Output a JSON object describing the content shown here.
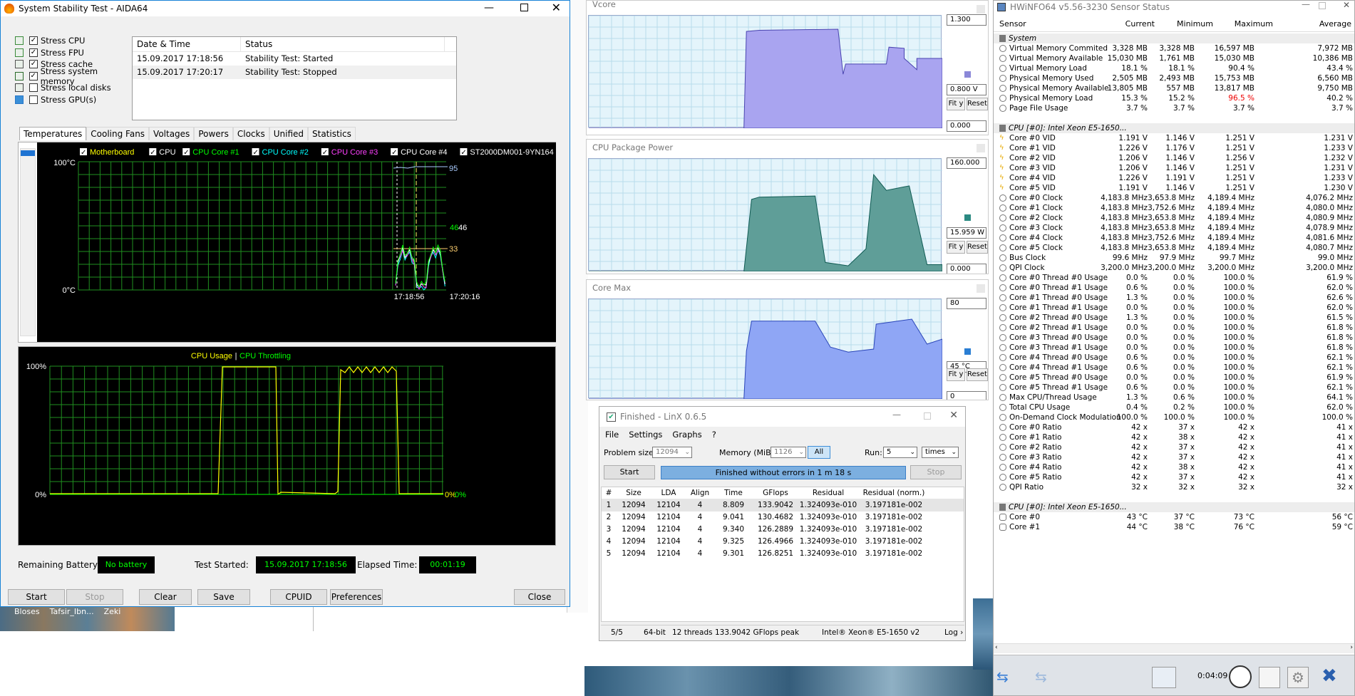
{
  "aida": {
    "title": "System Stability Test - AIDA64",
    "stress": [
      {
        "label": "Stress CPU",
        "checked": true
      },
      {
        "label": "Stress FPU",
        "checked": true
      },
      {
        "label": "Stress cache",
        "checked": true
      },
      {
        "label": "Stress system memory",
        "checked": true
      },
      {
        "label": "Stress local disks",
        "checked": false
      },
      {
        "label": "Stress GPU(s)",
        "checked": false
      }
    ],
    "log_headers": {
      "date": "Date & Time",
      "status": "Status"
    },
    "log": [
      {
        "date": "15.09.2017 17:18:56",
        "status": "Stability Test: Started"
      },
      {
        "date": "15.09.2017 17:20:17",
        "status": "Stability Test: Stopped"
      }
    ],
    "tabs": [
      "Temperatures",
      "Cooling Fans",
      "Voltages",
      "Powers",
      "Clocks",
      "Unified",
      "Statistics"
    ],
    "temp_legend": [
      {
        "label": "Motherboard",
        "color": "#ffff00"
      },
      {
        "label": "CPU",
        "color": "#ffffff"
      },
      {
        "label": "CPU Core #1",
        "color": "#00ff00"
      },
      {
        "label": "CPU Core #2",
        "color": "#00ffff"
      },
      {
        "label": "CPU Core #3",
        "color": "#ff40ff"
      },
      {
        "label": "CPU Core #4",
        "color": "#ffffff"
      },
      {
        "label": "ST2000DM001-9YN164",
        "color": "#ffffff"
      }
    ],
    "temp_chart": {
      "ymax": "100°C",
      "ymin": "0°C",
      "t1": "17:18:56",
      "t2": "17:20:16",
      "v95": "95",
      "v46a": "46",
      "v46b": "46",
      "v33": "33"
    },
    "usage_chart": {
      "title_a": "CPU Usage",
      "sep": "|",
      "title_b": "CPU Throttling",
      "ymax": "100%",
      "ymin": "0%",
      "end_a": "0%",
      "end_b": "0%"
    },
    "status": {
      "battery_label": "Remaining Battery:",
      "battery": "No battery",
      "started_label": "Test Started:",
      "started": "15.09.2017 17:18:56",
      "elapsed_label": "Elapsed Time:",
      "elapsed": "00:01:19"
    },
    "buttons": {
      "start": "Start",
      "stop": "Stop",
      "clear": "Clear",
      "save": "Save",
      "cpuid": "CPUID",
      "prefs": "Preferences",
      "close": "Close"
    }
  },
  "taskbar_items": [
    "Bloses",
    "Tafsir_Ibn...",
    "Zeki"
  ],
  "graphs": [
    {
      "title": "Vcore",
      "top": "1.300",
      "cur": "0.800 V",
      "bottom": "0.000",
      "swatch": "#8b88d8",
      "fity": "Fit y",
      "reset": "Reset"
    },
    {
      "title": "CPU Package Power",
      "top": "160.000",
      "cur": "15.959 W",
      "bottom": "0.000",
      "swatch": "#2b8a82",
      "fity": "Fit y",
      "reset": "Reset"
    },
    {
      "title": "Core Max",
      "top": "80",
      "cur": "45 °C",
      "bottom": "0",
      "swatch": "#2a7ed3",
      "fity": "Fit y",
      "reset": "Reset"
    }
  ],
  "linx": {
    "title": "Finished - LinX 0.6.5",
    "menu": [
      "File",
      "Settings",
      "Graphs",
      "?"
    ],
    "problem_label": "Problem size:",
    "problem": "12094",
    "memory_label": "Memory (MiB):",
    "memory": "1126",
    "all": "All",
    "run_label": "Run:",
    "run": "5",
    "times": "times",
    "start": "Start",
    "status": "Finished without errors in 1 m 18 s",
    "stop": "Stop",
    "headers": [
      "#",
      "Size",
      "LDA",
      "Align",
      "Time",
      "GFlops",
      "Residual",
      "Residual (norm.)"
    ],
    "rows": [
      [
        "1",
        "12094",
        "12104",
        "4",
        "8.809",
        "133.9042",
        "1.324093e-010",
        "3.197181e-002"
      ],
      [
        "2",
        "12094",
        "12104",
        "4",
        "9.041",
        "130.4682",
        "1.324093e-010",
        "3.197181e-002"
      ],
      [
        "3",
        "12094",
        "12104",
        "4",
        "9.340",
        "126.2889",
        "1.324093e-010",
        "3.197181e-002"
      ],
      [
        "4",
        "12094",
        "12104",
        "4",
        "9.325",
        "126.4966",
        "1.324093e-010",
        "3.197181e-002"
      ],
      [
        "5",
        "12094",
        "12104",
        "4",
        "9.301",
        "126.8251",
        "1.324093e-010",
        "3.197181e-002"
      ]
    ],
    "footer": {
      "runs": "5/5",
      "bits": "64-bit",
      "threads": "12 threads",
      "peak": "133.9042 GFlops peak",
      "cpu": "Intel® Xeon® E5-1650 v2",
      "log": "Log ›"
    }
  },
  "hwinfo": {
    "title": "HWiNFO64 v5.56-3230 Sensor Status",
    "headers": [
      "Sensor",
      "Current",
      "Minimum",
      "Maximum",
      "Average"
    ],
    "rows": [
      {
        "type": "group",
        "label": "System"
      },
      {
        "type": "row",
        "icon": "circle",
        "label": "Virtual Memory Commited",
        "v": [
          "3,328 MB",
          "3,328 MB",
          "16,597 MB",
          "7,972 MB"
        ]
      },
      {
        "type": "row",
        "icon": "circle",
        "label": "Virtual Memory Available",
        "v": [
          "15,030 MB",
          "1,761 MB",
          "15,030 MB",
          "10,386 MB"
        ]
      },
      {
        "type": "row",
        "icon": "circle",
        "label": "Virtual Memory Load",
        "v": [
          "18.1 %",
          "18.1 %",
          "90.4 %",
          "43.4 %"
        ]
      },
      {
        "type": "row",
        "icon": "circle",
        "label": "Physical Memory Used",
        "v": [
          "2,505 MB",
          "2,493 MB",
          "15,753 MB",
          "6,560 MB"
        ]
      },
      {
        "type": "row",
        "icon": "circle",
        "label": "Physical Memory Available",
        "v": [
          "13,805 MB",
          "557 MB",
          "13,817 MB",
          "9,750 MB"
        ]
      },
      {
        "type": "row",
        "icon": "circle",
        "label": "Physical Memory Load",
        "v": [
          "15.3 %",
          "15.2 %",
          "96.5 %",
          "40.2 %"
        ],
        "red": 2
      },
      {
        "type": "row",
        "icon": "circle",
        "label": "Page File Usage",
        "v": [
          "3.7 %",
          "3.7 %",
          "3.7 %",
          "3.7 %"
        ]
      },
      {
        "type": "blank"
      },
      {
        "type": "group",
        "label": "CPU [#0]: Intel Xeon E5-1650..."
      },
      {
        "type": "row",
        "icon": "bolt",
        "label": "Core #0 VID",
        "v": [
          "1.191 V",
          "1.146 V",
          "1.251 V",
          "1.231 V"
        ]
      },
      {
        "type": "row",
        "icon": "bolt",
        "label": "Core #1 VID",
        "v": [
          "1.226 V",
          "1.176 V",
          "1.251 V",
          "1.233 V"
        ]
      },
      {
        "type": "row",
        "icon": "bolt",
        "label": "Core #2 VID",
        "v": [
          "1.206 V",
          "1.146 V",
          "1.256 V",
          "1.232 V"
        ]
      },
      {
        "type": "row",
        "icon": "bolt",
        "label": "Core #3 VID",
        "v": [
          "1.206 V",
          "1.146 V",
          "1.251 V",
          "1.231 V"
        ]
      },
      {
        "type": "row",
        "icon": "bolt",
        "label": "Core #4 VID",
        "v": [
          "1.226 V",
          "1.191 V",
          "1.251 V",
          "1.233 V"
        ]
      },
      {
        "type": "row",
        "icon": "bolt",
        "label": "Core #5 VID",
        "v": [
          "1.191 V",
          "1.146 V",
          "1.251 V",
          "1.230 V"
        ]
      },
      {
        "type": "row",
        "icon": "circle",
        "label": "Core #0 Clock",
        "v": [
          "4,183.8 MHz",
          "3,653.8 MHz",
          "4,189.4 MHz",
          "4,076.2 MHz"
        ]
      },
      {
        "type": "row",
        "icon": "circle",
        "label": "Core #1 Clock",
        "v": [
          "4,183.8 MHz",
          "3,752.6 MHz",
          "4,189.4 MHz",
          "4,080.0 MHz"
        ]
      },
      {
        "type": "row",
        "icon": "circle",
        "label": "Core #2 Clock",
        "v": [
          "4,183.8 MHz",
          "3,653.8 MHz",
          "4,189.4 MHz",
          "4,080.9 MHz"
        ]
      },
      {
        "type": "row",
        "icon": "circle",
        "label": "Core #3 Clock",
        "v": [
          "4,183.8 MHz",
          "3,653.8 MHz",
          "4,189.4 MHz",
          "4,078.9 MHz"
        ]
      },
      {
        "type": "row",
        "icon": "circle",
        "label": "Core #4 Clock",
        "v": [
          "4,183.8 MHz",
          "3,752.6 MHz",
          "4,189.4 MHz",
          "4,081.6 MHz"
        ]
      },
      {
        "type": "row",
        "icon": "circle",
        "label": "Core #5 Clock",
        "v": [
          "4,183.8 MHz",
          "3,653.8 MHz",
          "4,189.4 MHz",
          "4,080.7 MHz"
        ]
      },
      {
        "type": "row",
        "icon": "circle",
        "label": "Bus Clock",
        "v": [
          "99.6 MHz",
          "97.9 MHz",
          "99.7 MHz",
          "99.0 MHz"
        ]
      },
      {
        "type": "row",
        "icon": "circle",
        "label": "QPI Clock",
        "v": [
          "3,200.0 MHz",
          "3,200.0 MHz",
          "3,200.0 MHz",
          "3,200.0 MHz"
        ]
      },
      {
        "type": "row",
        "icon": "circle",
        "label": "Core #0 Thread #0 Usage",
        "v": [
          "0.0 %",
          "0.0 %",
          "100.0 %",
          "61.9 %"
        ]
      },
      {
        "type": "row",
        "icon": "circle",
        "label": "Core #0 Thread #1 Usage",
        "v": [
          "0.6 %",
          "0.0 %",
          "100.0 %",
          "62.0 %"
        ]
      },
      {
        "type": "row",
        "icon": "circle",
        "label": "Core #1 Thread #0 Usage",
        "v": [
          "1.3 %",
          "0.0 %",
          "100.0 %",
          "62.6 %"
        ]
      },
      {
        "type": "row",
        "icon": "circle",
        "label": "Core #1 Thread #1 Usage",
        "v": [
          "0.0 %",
          "0.0 %",
          "100.0 %",
          "62.0 %"
        ]
      },
      {
        "type": "row",
        "icon": "circle",
        "label": "Core #2 Thread #0 Usage",
        "v": [
          "1.3 %",
          "0.0 %",
          "100.0 %",
          "61.5 %"
        ]
      },
      {
        "type": "row",
        "icon": "circle",
        "label": "Core #2 Thread #1 Usage",
        "v": [
          "0.0 %",
          "0.0 %",
          "100.0 %",
          "61.8 %"
        ]
      },
      {
        "type": "row",
        "icon": "circle",
        "label": "Core #3 Thread #0 Usage",
        "v": [
          "0.0 %",
          "0.0 %",
          "100.0 %",
          "61.8 %"
        ]
      },
      {
        "type": "row",
        "icon": "circle",
        "label": "Core #3 Thread #1 Usage",
        "v": [
          "0.0 %",
          "0.0 %",
          "100.0 %",
          "61.8 %"
        ]
      },
      {
        "type": "row",
        "icon": "circle",
        "label": "Core #4 Thread #0 Usage",
        "v": [
          "0.6 %",
          "0.0 %",
          "100.0 %",
          "62.1 %"
        ]
      },
      {
        "type": "row",
        "icon": "circle",
        "label": "Core #4 Thread #1 Usage",
        "v": [
          "0.6 %",
          "0.0 %",
          "100.0 %",
          "62.1 %"
        ]
      },
      {
        "type": "row",
        "icon": "circle",
        "label": "Core #5 Thread #0 Usage",
        "v": [
          "0.0 %",
          "0.0 %",
          "100.0 %",
          "61.9 %"
        ]
      },
      {
        "type": "row",
        "icon": "circle",
        "label": "Core #5 Thread #1 Usage",
        "v": [
          "0.6 %",
          "0.0 %",
          "100.0 %",
          "62.1 %"
        ]
      },
      {
        "type": "row",
        "icon": "circle",
        "label": "Max CPU/Thread Usage",
        "v": [
          "1.3 %",
          "0.6 %",
          "100.0 %",
          "64.1 %"
        ]
      },
      {
        "type": "row",
        "icon": "circle",
        "label": "Total CPU Usage",
        "v": [
          "0.4 %",
          "0.2 %",
          "100.0 %",
          "62.0 %"
        ]
      },
      {
        "type": "row",
        "icon": "circle",
        "label": "On-Demand Clock Modulation",
        "v": [
          "100.0 %",
          "100.0 %",
          "100.0 %",
          "100.0 %"
        ]
      },
      {
        "type": "row",
        "icon": "circle",
        "label": "Core #0 Ratio",
        "v": [
          "42 x",
          "37 x",
          "42 x",
          "41 x"
        ]
      },
      {
        "type": "row",
        "icon": "circle",
        "label": "Core #1 Ratio",
        "v": [
          "42 x",
          "38 x",
          "42 x",
          "41 x"
        ]
      },
      {
        "type": "row",
        "icon": "circle",
        "label": "Core #2 Ratio",
        "v": [
          "42 x",
          "37 x",
          "42 x",
          "41 x"
        ]
      },
      {
        "type": "row",
        "icon": "circle",
        "label": "Core #3 Ratio",
        "v": [
          "42 x",
          "37 x",
          "42 x",
          "41 x"
        ]
      },
      {
        "type": "row",
        "icon": "circle",
        "label": "Core #4 Ratio",
        "v": [
          "42 x",
          "38 x",
          "42 x",
          "41 x"
        ]
      },
      {
        "type": "row",
        "icon": "circle",
        "label": "Core #5 Ratio",
        "v": [
          "42 x",
          "37 x",
          "42 x",
          "41 x"
        ]
      },
      {
        "type": "row",
        "icon": "circle",
        "label": "QPI Ratio",
        "v": [
          "32 x",
          "32 x",
          "32 x",
          "32 x"
        ]
      },
      {
        "type": "blank"
      },
      {
        "type": "group",
        "label": "CPU [#0]: Intel Xeon E5-1650..."
      },
      {
        "type": "row",
        "icon": "therm",
        "label": "Core #0",
        "v": [
          "43 °C",
          "37 °C",
          "73 °C",
          "56 °C"
        ]
      },
      {
        "type": "row",
        "icon": "therm",
        "label": "Core #1",
        "v": [
          "44 °C",
          "38 °C",
          "76 °C",
          "59 °C"
        ]
      }
    ],
    "elapsed": "0:04:09"
  }
}
